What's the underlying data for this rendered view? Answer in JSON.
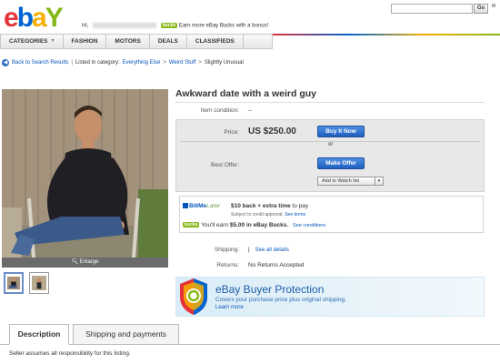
{
  "header": {
    "logo": [
      "e",
      "b",
      "a",
      "Y"
    ],
    "greeting_prefix": "Hi,",
    "bucks_badge": "bucks",
    "greeting_promo": "Earn more eBay Bucks with a bonus!",
    "go_label": "Go",
    "my_ebay": "M"
  },
  "nav": {
    "items": [
      {
        "label": "CATEGORIES",
        "has_dropdown": true
      },
      {
        "label": "FASHION"
      },
      {
        "label": "MOTORS"
      },
      {
        "label": "DEALS"
      },
      {
        "label": "CLASSIFIEDS"
      }
    ]
  },
  "breadcrumb": {
    "back": "Back to Search Results",
    "listed_in": "Listed in category:",
    "path": [
      "Everything Else",
      "Weird Stuff",
      "Slightly Unusual"
    ],
    "separator": ">"
  },
  "gallery": {
    "enlarge": "Enlarge"
  },
  "item": {
    "title": "Awkward date with a weird guy",
    "condition_label": "Item condition:",
    "condition_value": "--",
    "price_label": "Price:",
    "price_value": "US $250.00",
    "buy_now": "Buy It Now",
    "or": "or",
    "best_offer_label": "Best Offer:",
    "make_offer": "Make Offer",
    "watch_list": "Add to Watch list",
    "shipping_label": "Shipping:",
    "shipping_link": "See all details",
    "returns_label": "Returns:",
    "returns_value": "No Returns Accepted"
  },
  "promo": {
    "bml_brand": "BillMe",
    "bml_later": "Later",
    "bml_offer": "$10 back + extra time",
    "bml_to_pay": "to pay",
    "bml_sub": "Subject to credit approval.",
    "bml_terms": "See terms",
    "bucks_badge": "bucks",
    "bucks_text_pre": "You'll earn",
    "bucks_amount": "$5.00 in eBay Bucks.",
    "bucks_link": "See conditions"
  },
  "protection": {
    "title": "eBay Buyer Protection",
    "subtitle": "Covers your purchase price plus original shipping.",
    "link": "Learn more"
  },
  "tabs": [
    {
      "label": "Description",
      "active": true
    },
    {
      "label": "Shipping and payments",
      "active": false
    }
  ],
  "seller_note": "Seller assumes all responsibility for this listing.",
  "colors": {
    "ebay_red": "#e53238",
    "ebay_blue": "#0064d2",
    "ebay_yellow": "#f5af02",
    "ebay_green": "#86b817",
    "link": "#0654ba",
    "button_blue": "#1f5fbf"
  }
}
